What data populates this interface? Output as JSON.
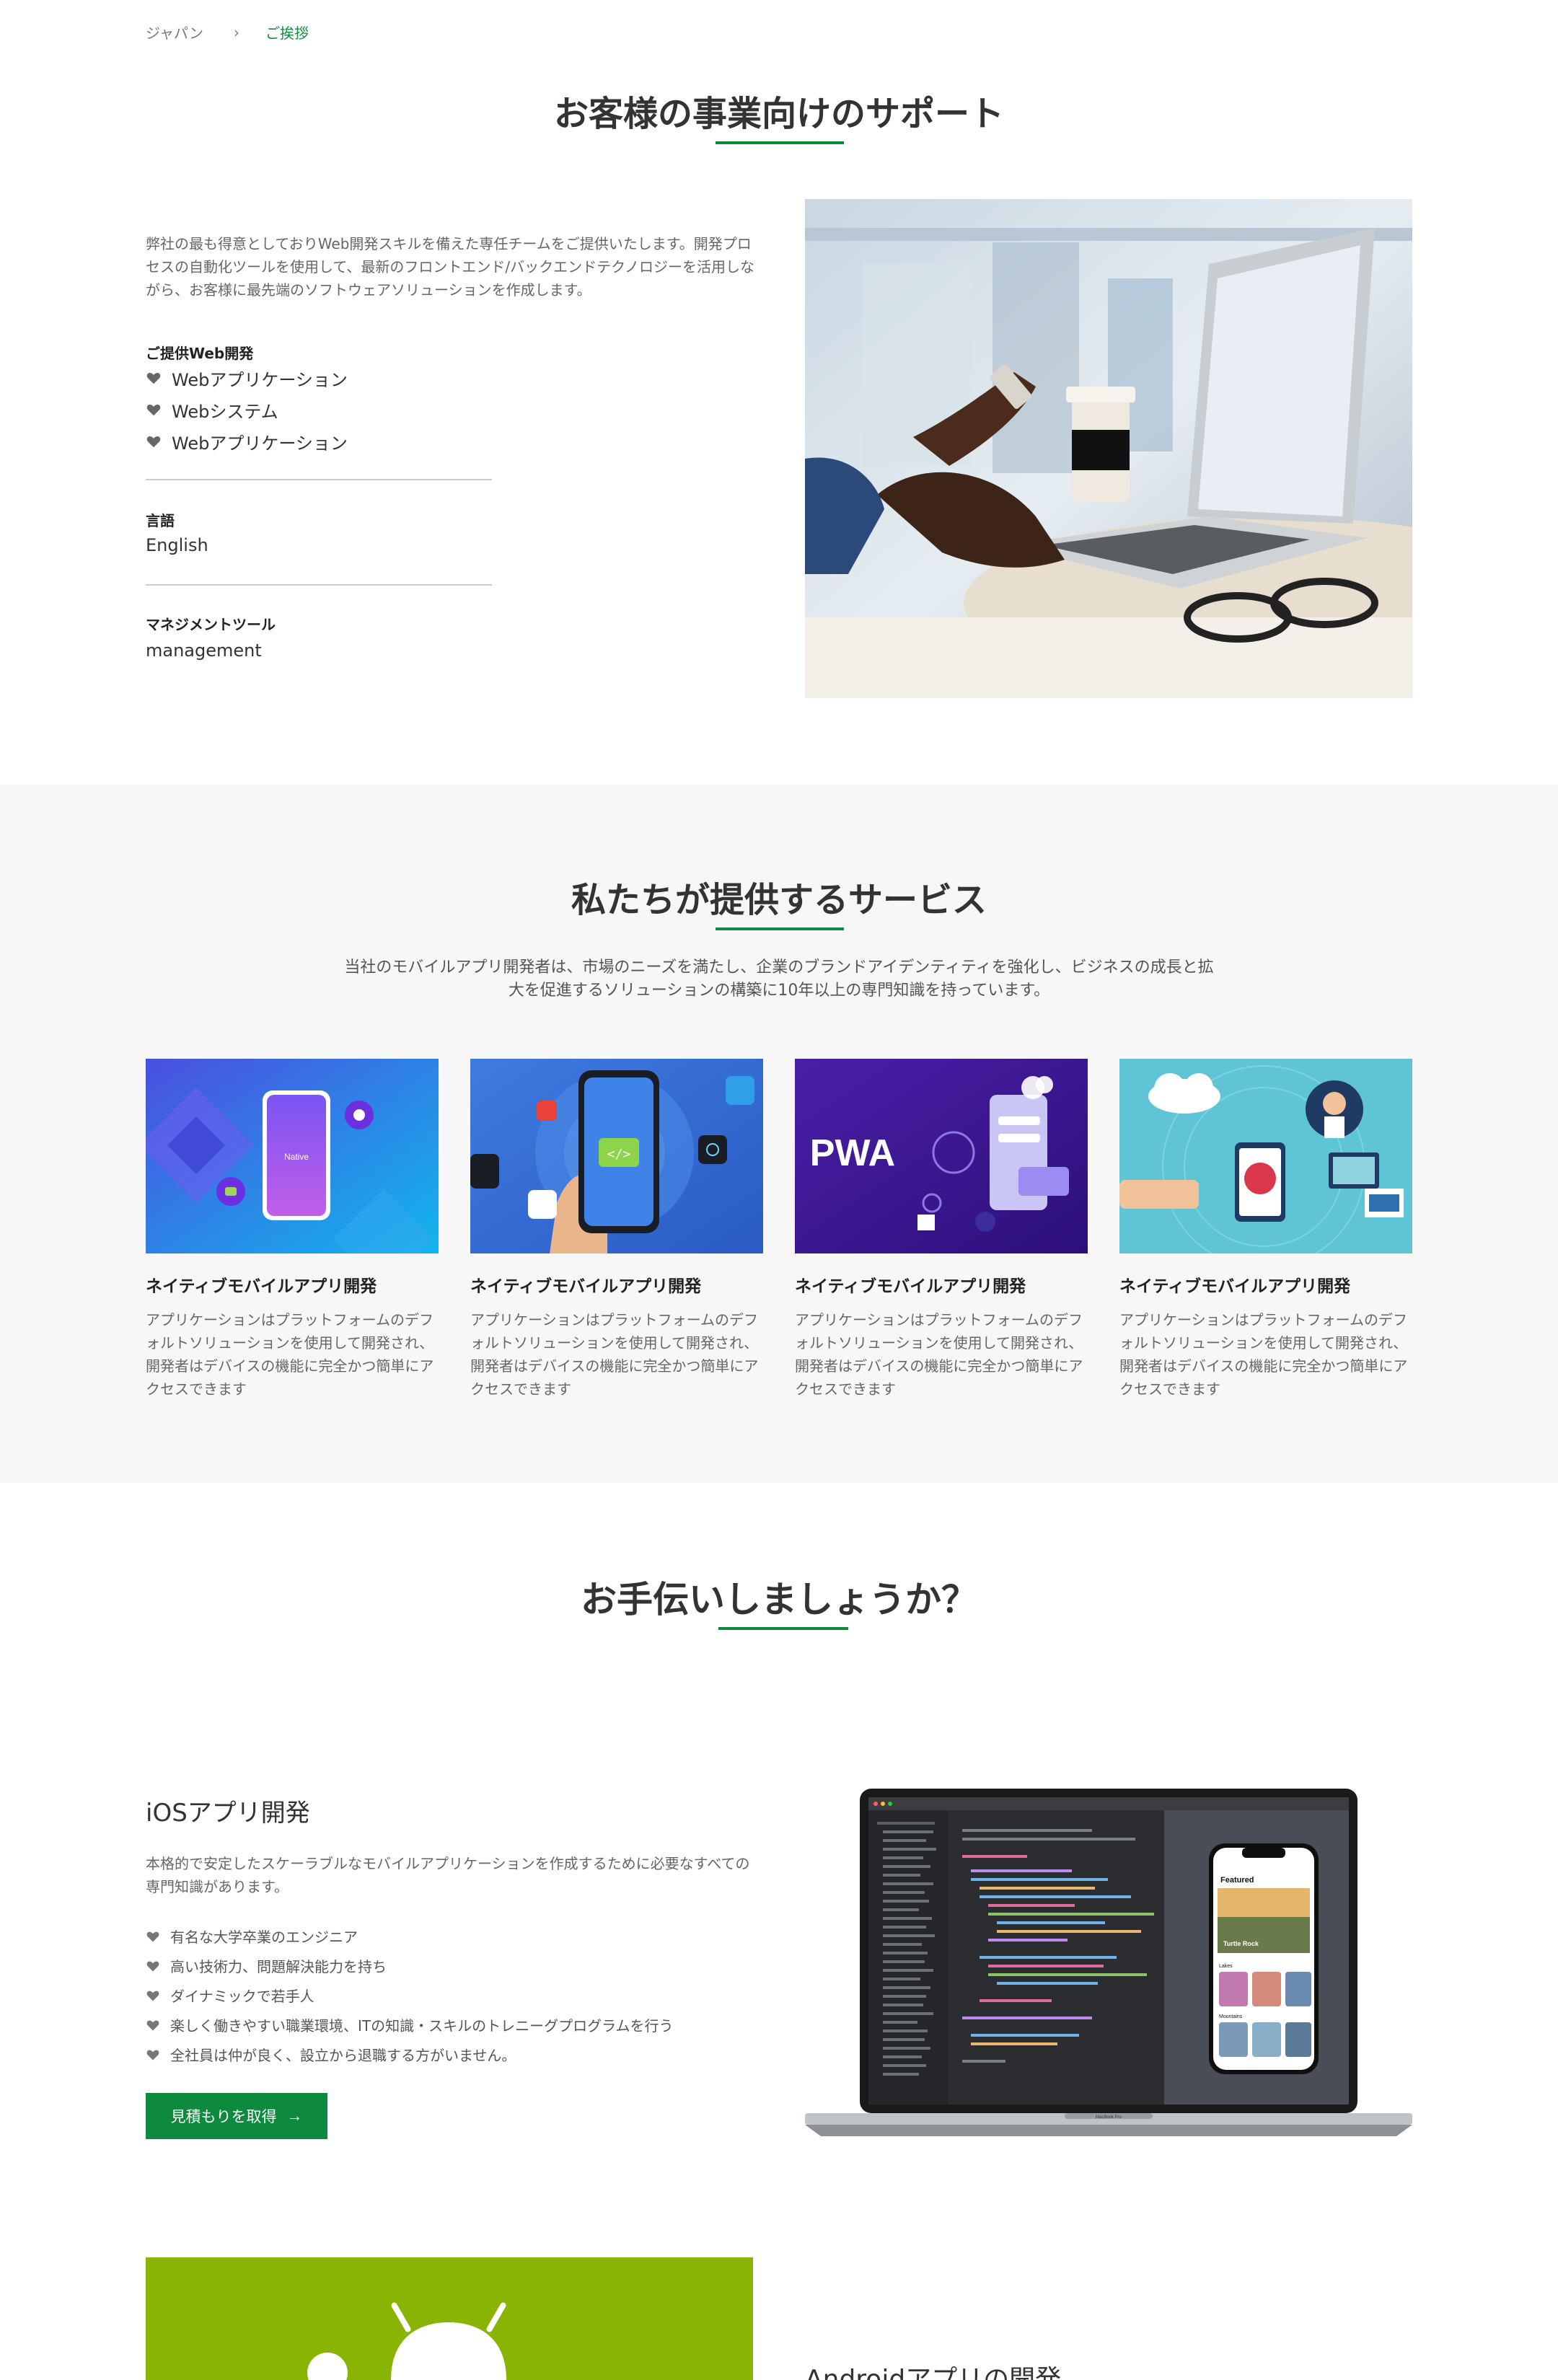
{
  "breadcrumb": {
    "home": "ジャパン",
    "separator": "›",
    "current": "ご挨拶"
  },
  "section1": {
    "title": "お客様の事業向けのサポート",
    "intro": "弊社の最も得意としておりWeb開発スキルを備えた専任チームをご提供いたします。開発プロセスの自動化ツールを使用して、最新のフロントエンド/バックエンドテクノロジーを活用しながら、お客様に最先端のソフトウェアソリューションを作成します。",
    "web_label": "ご提供Web開発",
    "web_items": [
      "Webアプリケーション",
      "Webシステム",
      "Webアプリケーション"
    ],
    "language_label": "言語",
    "language_value": "English",
    "tool_label": "マネジメントツール",
    "tool_value": "management"
  },
  "section2": {
    "title": "私たちが提供するサービス",
    "description": "当社のモバイルアプリ開発者は、市場のニーズを満たし、企業のブランドアイデンティティを強化し、ビジネスの成長と拡大を促進するソリューションの構築に10年以上の専門知識を持っています。",
    "cards": [
      {
        "title": "ネイティブモバイルアプリ開発",
        "text": "アプリケーションはプラットフォームのデフォルトソリューションを使用して開発され、開発者はデバイスの機能に完全かつ簡単にアクセスできます",
        "phone_label": "Native"
      },
      {
        "title": "ネイティブモバイルアプリ開発",
        "text": "アプリケーションはプラットフォームのデフォルトソリューションを使用して開発され、開発者はデバイスの機能に完全かつ簡単にアクセスできます"
      },
      {
        "title": "ネイティブモバイルアプリ開発",
        "text": "アプリケーションはプラットフォームのデフォルトソリューションを使用して開発され、開発者はデバイスの機能に完全かつ簡単にアクセスできます",
        "logo_text": "PWA"
      },
      {
        "title": "ネイティブモバイルアプリ開発",
        "text": "アプリケーションはプラットフォームのデフォルトソリューションを使用して開発され、開発者はデバイスの機能に完全かつ簡単にアクセスできます"
      }
    ]
  },
  "section3": {
    "title": "お手伝いしましょうか？",
    "ios_title": "iOSアプリ開発",
    "ios_intro": "本格的で安定したスケーラブルなモバイルアプリケーションを作成するために必要なすべての専門知識があります。",
    "ios_points": [
      "有名な大学卒業のエンジニア",
      "高い技術力、問題解決能力を持ち",
      "ダイナミックで若手人",
      "楽しく働きやすい職業環境、ITの知識・スキルのトレニーグプログラムを行う",
      "全社員は仲が良く、設立から退職する方がいません。"
    ],
    "cta_label": "見積もりを取得",
    "cta_arrow": "→",
    "phone_featured": "Featured",
    "phone_turtle": "Turtle Rock",
    "phone_lakes": "Lakes",
    "phone_mountains": "Mountains",
    "laptop_brand": "MacBook Pro",
    "android_title": "Androidアプリの開発"
  },
  "colors": {
    "accent": "#0e8a3f",
    "android_bg": "#8ab403",
    "section_bg": "#f7f7f7"
  }
}
